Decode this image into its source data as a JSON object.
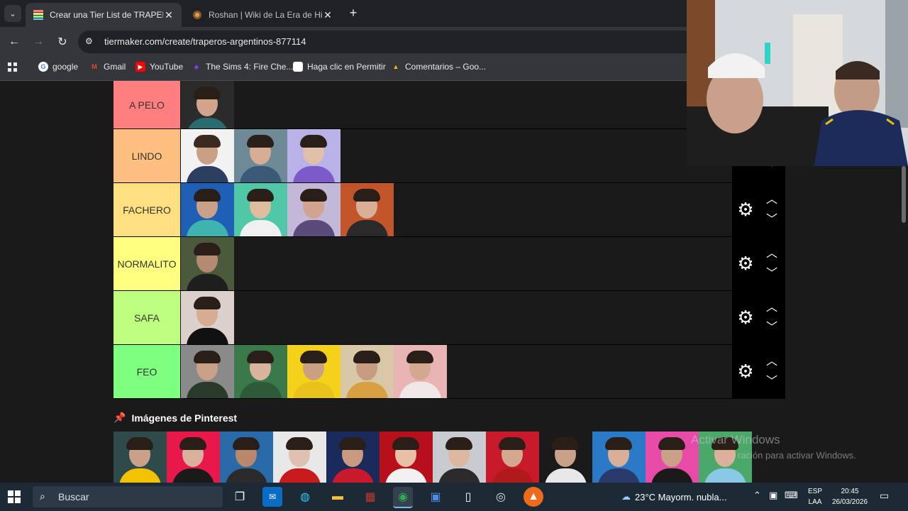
{
  "browser": {
    "tabs": [
      {
        "title": "Crear una Tier List de TRAPEROS",
        "active": true
      },
      {
        "title": "Roshan | Wiki de La Era de Hielo",
        "active": false
      }
    ],
    "url": "tiermaker.com/create/traperos-argentinos-877114",
    "bookmarks": [
      "google",
      "Gmail",
      "YouTube",
      "The Sims 4: Fire Che...",
      "Haga clic en Permitir",
      "Comentarios – Goo..."
    ]
  },
  "tierlist": {
    "tiers": [
      {
        "label": "A PELO",
        "color": "#ff7f7f",
        "count": 1
      },
      {
        "label": "LINDO",
        "color": "#ffbf7f",
        "count": 3
      },
      {
        "label": "FACHERO",
        "color": "#ffdf7f",
        "count": 4
      },
      {
        "label": "NORMALITO",
        "color": "#ffff7f",
        "count": 1
      },
      {
        "label": "SAFA",
        "color": "#bfff7f",
        "count": 1
      },
      {
        "label": "FEO",
        "color": "#7fff7f",
        "count": 5
      }
    ],
    "pool_title": "Imágenes de Pinterest",
    "pool_count": 12
  },
  "overlay": {
    "watermark_title": "Activar Windows",
    "watermark_sub": "ración para activar Windows."
  },
  "taskbar": {
    "search_placeholder": "Buscar",
    "weather": "23°C  Mayorm. nubla...",
    "lang_line1": "ESP",
    "lang_line2": "LAA",
    "time": "20:45",
    "date": "26/03/2026"
  }
}
